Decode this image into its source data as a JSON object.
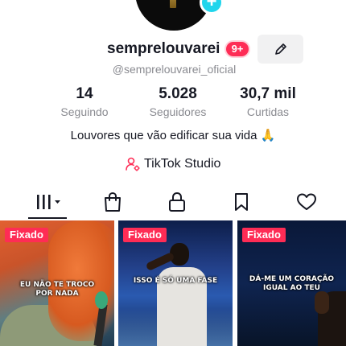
{
  "profile": {
    "username": "semprelouvarei",
    "notification_badge": "9+",
    "handle": "@semprelouvarei_oficial",
    "bio": "Louvores que vão edificar sua vida 🙏",
    "studio_label": "TikTok Studio"
  },
  "stats": [
    {
      "value": "14",
      "label": "Seguindo"
    },
    {
      "value": "5.028",
      "label": "Seguidores"
    },
    {
      "value": "30,7 mil",
      "label": "Curtidas"
    }
  ],
  "tabs": [
    {
      "icon": "grid-icon",
      "active": true
    },
    {
      "icon": "shopping-bag-icon",
      "active": false
    },
    {
      "icon": "lock-icon",
      "active": false
    },
    {
      "icon": "bookmark-icon",
      "active": false
    },
    {
      "icon": "heart-icon",
      "active": false
    }
  ],
  "videos": [
    {
      "pinned_label": "Fixado",
      "caption": "EU NÃO TE TROCO POR NADA"
    },
    {
      "pinned_label": "Fixado",
      "caption": "ISSO É SÓ UMA FASE"
    },
    {
      "pinned_label": "Fixado",
      "caption": "DÁ-ME UM CORAÇÃO IGUAL AO TEU"
    }
  ],
  "colors": {
    "accent": "#fe2c55",
    "avatar_plus": "#20d5ec",
    "text_primary": "#161823",
    "text_secondary": "#8a8b91"
  }
}
